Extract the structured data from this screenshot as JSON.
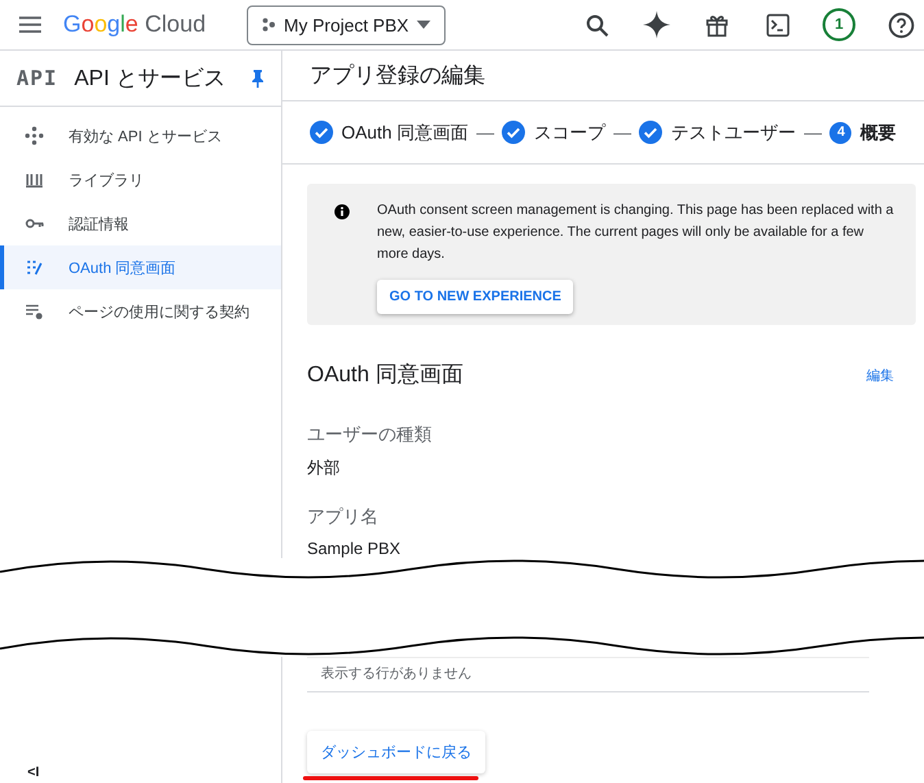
{
  "topbar": {
    "logo_google": "Google",
    "logo_cloud": "Cloud",
    "project": "My Project PBX",
    "badge": "1"
  },
  "sidebar": {
    "api_mark": "API",
    "title": "API とサービス",
    "items": [
      {
        "label": "有効な API とサービス",
        "kind": "services",
        "selected": false
      },
      {
        "label": "ライブラリ",
        "kind": "library",
        "selected": false
      },
      {
        "label": "認証情報",
        "kind": "key",
        "selected": false
      },
      {
        "label": "OAuth 同意画面",
        "kind": "consent",
        "selected": true
      },
      {
        "label": "ページの使用に関する契約",
        "kind": "settings",
        "selected": false
      }
    ],
    "collapse": "<I"
  },
  "page": {
    "title": "アプリ登録の編集",
    "steps": [
      {
        "label": "OAuth 同意画面",
        "done": true,
        "selected": false
      },
      {
        "separator": "—",
        "label": "スコープ",
        "done": true,
        "selected": false
      },
      {
        "separator": "—",
        "label": "テストユーザー",
        "done": true,
        "selected": false
      },
      {
        "separator": "—",
        "label": "概要",
        "done": false,
        "number": "4",
        "selected": true
      }
    ],
    "notice": {
      "text": "OAuth consent screen management is changing. This page has been replaced with a new, easier-to-use experience. The current pages will only be available for a few more days.",
      "button": "GO TO NEW EXPERIENCE"
    },
    "section": {
      "title": "OAuth 同意画面",
      "edit": "編集",
      "fields": [
        {
          "label": "ユーザーの種類",
          "value": "外部"
        },
        {
          "label": "アプリ名",
          "value": "Sample PBX"
        }
      ]
    },
    "empty_table": "表示する行がありません",
    "back_button": {
      "label": "ダッシュボードに戻る",
      "underlined": true
    }
  }
}
